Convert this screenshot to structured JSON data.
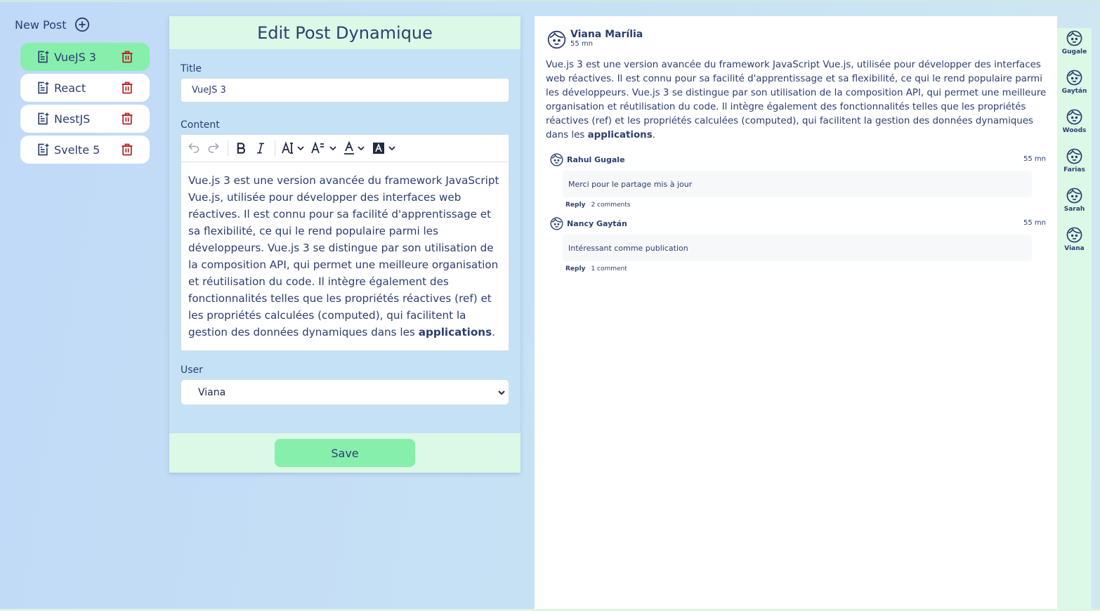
{
  "sidebar": {
    "new_post_label": "New Post",
    "posts": [
      {
        "label": "VueJS 3",
        "active": true
      },
      {
        "label": "React",
        "active": false
      },
      {
        "label": "NestJS",
        "active": false
      },
      {
        "label": "Svelte 5",
        "active": false
      }
    ]
  },
  "editor": {
    "heading": "Edit Post Dynamique",
    "title_label": "Title",
    "title_value": "VueJS 3",
    "content_label": "Content",
    "content_text": "Vue.js 3 est une version avancée du framework JavaScript Vue.js, utilisée pour développer des interfaces web réactives. Il est connu pour sa facilité d'apprentissage et sa flexibilité, ce qui le rend populaire parmi les développeurs. Vue.js 3 se distingue par son utilisation de la composition API, qui permet une meilleure organisation et réutilisation du code. Il intègre également des fonctionnalités telles que les propriétés réactives (ref) et les propriétés calculées (computed), qui facilitent la gestion des données dynamiques dans les ",
    "content_bold": "applications",
    "content_end": ".",
    "user_label": "User",
    "user_selected": "Viana",
    "save_label": "Save",
    "toolbar_icons": [
      "undo-icon",
      "redo-icon",
      "bold-icon",
      "italic-icon",
      "font-size-icon",
      "line-height-icon",
      "font-color-icon",
      "highlight-color-icon"
    ]
  },
  "preview": {
    "author": "Viana Marília",
    "time": "55 mn",
    "body_text": "Vue.js 3 est une version avancée du framework JavaScript Vue.js, utilisée pour développer des interfaces web réactives. Il est connu pour sa facilité d'apprentissage et sa flexibilité, ce qui le rend populaire parmi les développeurs. Vue.js 3 se distingue par son utilisation de la composition API, qui permet une meilleure organisation et réutilisation du code. Il intègre également des fonctionnalités telles que les propriétés réactives (ref) et les propriétés calculées (computed), qui facilitent la gestion des données dynamiques dans les ",
    "body_bold": "applications",
    "body_end": ".",
    "comments": [
      {
        "author": "Rahul Gugale",
        "time": "55 mn",
        "text": "Merci pour le partage mis à jour",
        "reply": "Reply",
        "count": "2 comments"
      },
      {
        "author": "Nancy Gaytán",
        "time": "55 mn",
        "text": "Intéressant comme publication",
        "reply": "Reply",
        "count": "1 comment"
      }
    ]
  },
  "users_rail": [
    "Gugale",
    "Gaytán",
    "Woods",
    "Farias",
    "Sarah",
    "Viana"
  ],
  "colors": {
    "accent_green": "#86efac",
    "header_green": "#dcf8e6",
    "text_navy": "#2c3e70",
    "trash_red": "#b91c1c"
  }
}
